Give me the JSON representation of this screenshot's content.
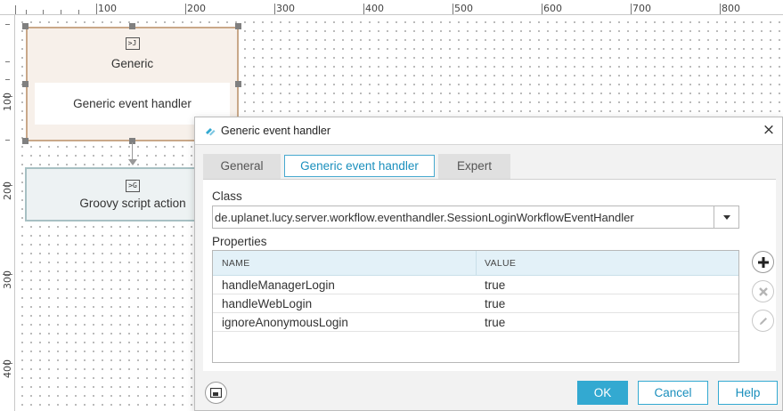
{
  "ruler": {
    "top_labels": [
      "100",
      "200",
      "300",
      "400",
      "500",
      "600",
      "700",
      "800"
    ],
    "left_labels": [
      "100",
      "200",
      "300",
      "400"
    ]
  },
  "canvas": {
    "generic_node": {
      "icon_glyph": ">J",
      "title": "Generic",
      "subtitle": "Generic event handler"
    },
    "groovy_node": {
      "icon_glyph": ">G",
      "title": "Groovy script action"
    }
  },
  "dialog": {
    "title": "Generic event handler",
    "close_glyph": "×",
    "tabs": [
      {
        "label": "General",
        "active": false
      },
      {
        "label": "Generic event handler",
        "active": true
      },
      {
        "label": "Expert",
        "active": false
      }
    ],
    "class_label": "Class",
    "class_value": "de.uplanet.lucy.server.workflow.eventhandler.SessionLoginWorkflowEventHandler",
    "properties_label": "Properties",
    "table": {
      "columns": [
        "NAME",
        "VALUE"
      ],
      "rows": [
        {
          "name": "handleManagerLogin",
          "value": "true"
        },
        {
          "name": "handleWebLogin",
          "value": "true"
        },
        {
          "name": "ignoreAnonymousLogin",
          "value": "true"
        }
      ]
    },
    "side_buttons": [
      "add-icon",
      "remove-icon",
      "edit-icon"
    ],
    "buttons": {
      "ok": "OK",
      "cancel": "Cancel",
      "help": "Help"
    }
  },
  "colors": {
    "accent": "#33a9d1",
    "tab_active_text": "#1a8fbd",
    "generic_node_fill": "#f7f0ea",
    "generic_node_border": "#c9a889",
    "groovy_node_fill": "#edf2f3",
    "groovy_node_border": "#a7c0c3",
    "table_header": "#e3f1f8"
  }
}
